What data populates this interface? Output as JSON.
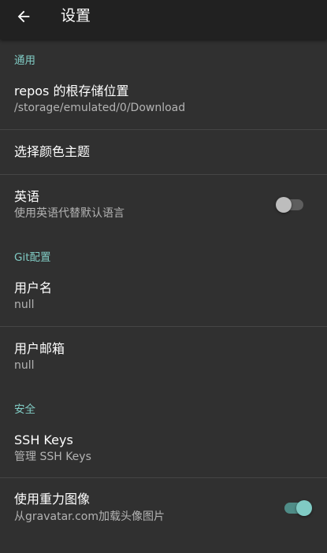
{
  "appbar": {
    "title": "设置",
    "back_icon": "arrow-left-icon"
  },
  "colors": {
    "accent": "#80cbc4",
    "background": "#303030",
    "appbar": "#212121"
  },
  "sections": {
    "general": {
      "header": "通用",
      "repo_location": {
        "title": "repos 的根存储位置",
        "summary": "/storage/emulated/0/Download"
      },
      "color_theme": {
        "title": "选择颜色主题"
      },
      "english": {
        "title": "英语",
        "summary": "使用英语代替默认语言",
        "enabled": false
      }
    },
    "git": {
      "header": "Git配置",
      "username": {
        "title": "用户名",
        "summary": "null"
      },
      "email": {
        "title": "用户邮箱",
        "summary": "null"
      }
    },
    "security": {
      "header": "安全",
      "ssh_keys": {
        "title": "SSH Keys",
        "summary": "管理 SSH Keys"
      },
      "gravatar": {
        "title": "使用重力图像",
        "summary": "从gravatar.com加载头像图片",
        "enabled": true
      }
    }
  }
}
